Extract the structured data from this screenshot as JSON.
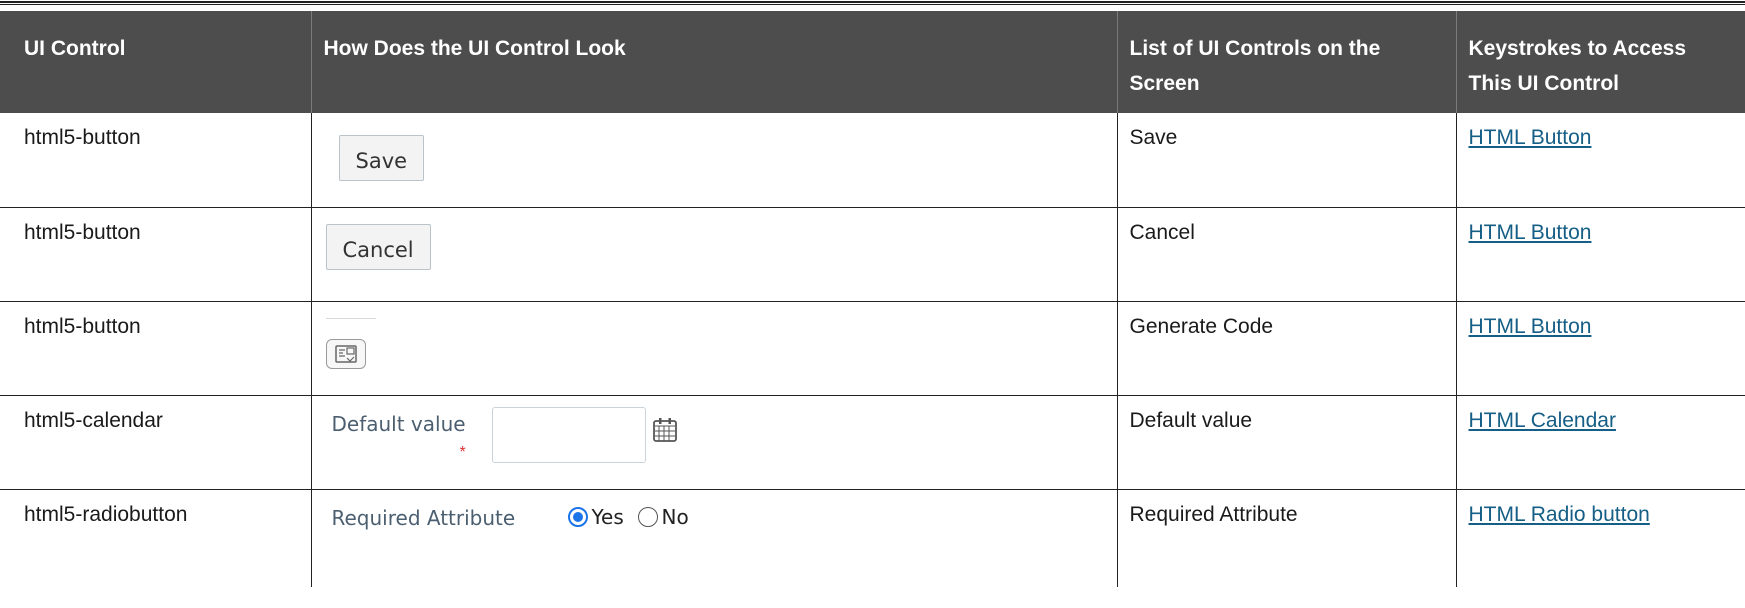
{
  "headers": {
    "col1": "UI Control",
    "col2": "How Does the UI Control Look",
    "col3": "List of UI Controls on the Screen",
    "col4": "Keystrokes to Access This UI Control"
  },
  "rows": [
    {
      "control": "html5-button",
      "look": {
        "button_label": "Save"
      },
      "list": "Save",
      "link": "HTML Button"
    },
    {
      "control": "html5-button",
      "look": {
        "button_label": "Cancel"
      },
      "list": "Cancel",
      "link": "HTML Button"
    },
    {
      "control": "html5-button",
      "look": {
        "icon": "generate-code-icon"
      },
      "list": "Generate Code",
      "link": "HTML Button"
    },
    {
      "control": "html5-calendar",
      "look": {
        "label": "Default value",
        "required_mark": "*",
        "value": "",
        "icon": "calendar-icon"
      },
      "list": "Default value",
      "link": "HTML Calendar"
    },
    {
      "control": "html5-radiobutton",
      "look": {
        "label": "Required Attribute",
        "options": [
          "Yes",
          "No"
        ],
        "selected": "Yes"
      },
      "list": "Required Attribute",
      "link": "HTML Radio button"
    }
  ],
  "colors": {
    "header_bg": "#4d4d4d",
    "link": "#155e86",
    "radio_accent": "#1b74e8",
    "required": "#dd3333"
  }
}
